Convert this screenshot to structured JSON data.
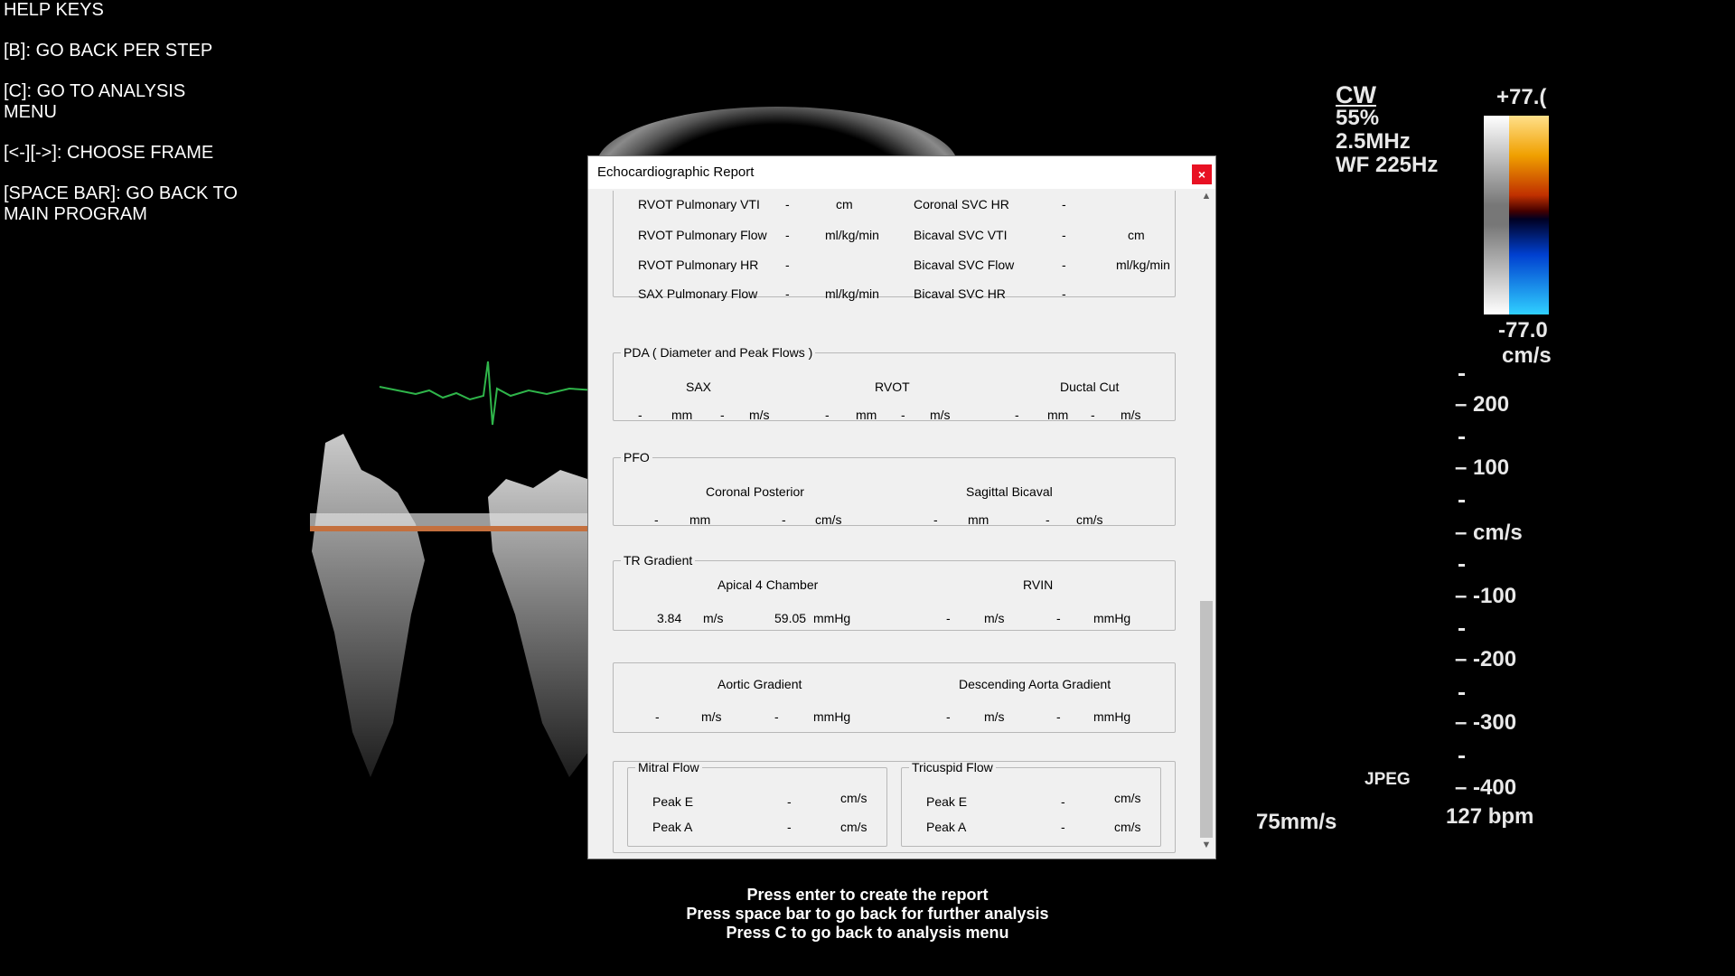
{
  "help": {
    "title": "HELP KEYS",
    "b": " [B]: GO BACK PER STEP",
    "c1": " [C]: GO TO ANALYSIS",
    "c2": "MENU",
    "frame": " [<-][->]:  CHOOSE  FRAME",
    "space1": " [SPACE BAR]: GO BACK TO",
    "space2": "MAIN PROGRAM"
  },
  "scanner": {
    "mode": "CW",
    "gain": "55%",
    "freq": "2.5MHz",
    "wall_filter": "WF 225Hz",
    "vel_max": "+77.(",
    "vel_min": "-77.0",
    "vel_unit": "cm/s",
    "scale": [
      "200",
      "100",
      "cm/s",
      "-100",
      "-200",
      "-300",
      "-400"
    ],
    "format": "JPEG",
    "sweep": "75mm/s",
    "hr": "127 bpm"
  },
  "dialog": {
    "title": "Echocardiographic Report",
    "close": "×",
    "rvot": {
      "rows": [
        {
          "l": "RVOT Pulmonary VTI",
          "v": "-",
          "u": "cm",
          "l2": "Coronal SVC HR",
          "v2": "-",
          "u2": ""
        },
        {
          "l": "RVOT Pulmonary Flow",
          "v": "-",
          "u": "ml/kg/min",
          "l2": "Bicaval SVC VTI",
          "v2": "-",
          "u2": "cm"
        },
        {
          "l": "RVOT Pulmonary HR",
          "v": "-",
          "u": "",
          "l2": "Bicaval SVC Flow",
          "v2": "-",
          "u2": "ml/kg/min"
        },
        {
          "l": "SAX Pulmonary Flow",
          "v": "-",
          "u": "ml/kg/min",
          "l2": "Bicaval SVC HR",
          "v2": "-",
          "u2": ""
        }
      ]
    },
    "pda": {
      "legend": "PDA ( Diameter and Peak Flows )",
      "cols": [
        {
          "name": "SAX",
          "d": "-",
          "du": "mm",
          "v": "-",
          "vu": "m/s"
        },
        {
          "name": "RVOT",
          "d": "-",
          "du": "mm",
          "v": "-",
          "vu": "m/s"
        },
        {
          "name": "Ductal Cut",
          "d": "-",
          "du": "mm",
          "v": "-",
          "vu": "m/s"
        }
      ]
    },
    "pfo": {
      "legend": "PFO",
      "cols": [
        {
          "name": "Coronal Posterior",
          "d": "-",
          "du": "mm",
          "v": "-",
          "vu": "cm/s"
        },
        {
          "name": "Sagittal Bicaval",
          "d": "-",
          "du": "mm",
          "v": "-",
          "vu": "cm/s"
        }
      ]
    },
    "tr": {
      "legend": "TR Gradient",
      "cols": [
        {
          "name": "Apical 4 Chamber",
          "v": "3.84",
          "vu": "m/s",
          "g": "59.05",
          "gu": "mmHg"
        },
        {
          "name": "RVIN",
          "v": "-",
          "vu": "m/s",
          "g": "-",
          "gu": "mmHg"
        }
      ]
    },
    "aortic": {
      "cols": [
        {
          "name": "Aortic Gradient",
          "v": "-",
          "vu": "m/s",
          "g": "-",
          "gu": "mmHg"
        },
        {
          "name": "Descending Aorta Gradient",
          "v": "-",
          "vu": "m/s",
          "g": "-",
          "gu": "mmHg"
        }
      ]
    },
    "mitral": {
      "legend": "Mitral Flow",
      "e": {
        "l": "Peak E",
        "v": "-",
        "u": "cm/s"
      },
      "a": {
        "l": "Peak A",
        "v": "-",
        "u": "cm/s"
      }
    },
    "tricuspid": {
      "legend": "Tricuspid Flow",
      "e": {
        "l": "Peak E",
        "v": "-",
        "u": "cm/s"
      },
      "a": {
        "l": "Peak A",
        "v": "-",
        "u": "cm/s"
      }
    }
  },
  "instructions": {
    "l1": "Press enter to create the report",
    "l2": "Press space bar to go back for further analysis",
    "l3": "Press C to go back to analysis menu"
  }
}
